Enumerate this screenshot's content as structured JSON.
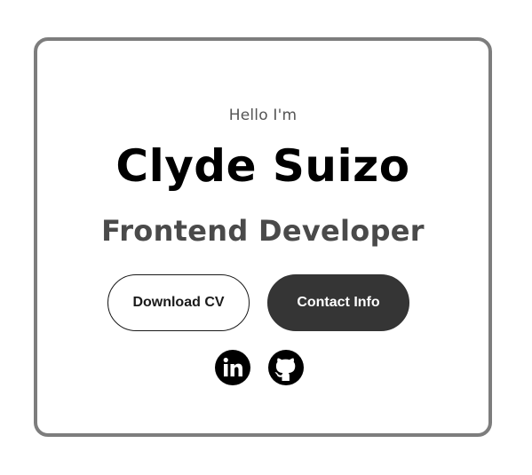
{
  "hero": {
    "greeting": "Hello I'm",
    "name": "Clyde Suizo",
    "role": "Frontend Developer"
  },
  "buttons": {
    "download_cv": "Download CV",
    "contact_info": "Contact Info"
  },
  "socials": [
    {
      "icon": "linkedin-icon"
    },
    {
      "icon": "github-icon"
    }
  ],
  "colors": {
    "card_border": "#7d7d7d",
    "primary_text": "#000000",
    "secondary_text": "#4a4a4a",
    "filled_button": "#353535"
  }
}
